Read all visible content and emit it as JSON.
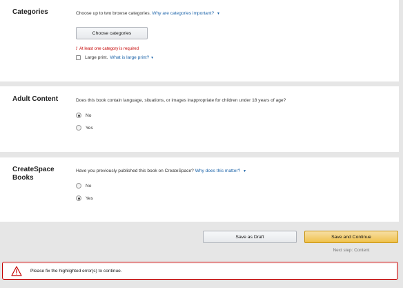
{
  "categories": {
    "title": "Categories",
    "question": "Choose up to two browse categories.",
    "help_link": "Why are categories important?",
    "choose_button": "Choose categories",
    "error": "At least one category is required",
    "large_print_label": "Large print.",
    "large_print_link": "What is large print?"
  },
  "adult": {
    "title": "Adult Content",
    "question": "Does this book contain language, situations, or images inappropriate for children under 18 years of age?",
    "options": [
      {
        "label": "No",
        "checked": true
      },
      {
        "label": "Yes",
        "checked": false
      }
    ]
  },
  "createspace": {
    "title": "CreateSpace Books",
    "question": "Have you previously published this book on CreateSpace?",
    "help_link": "Why does this matter?",
    "options": [
      {
        "label": "No",
        "checked": false
      },
      {
        "label": "Yes",
        "checked": true
      }
    ]
  },
  "footer": {
    "save_draft": "Save as Draft",
    "save_continue": "Save and Continue",
    "next_step": "Next step: Content"
  },
  "alert": {
    "message": "Please fix the highlighted error(s) to continue."
  },
  "icons": {
    "chevron": "chevron-down-icon",
    "alert": "warning-triangle-icon"
  },
  "colors": {
    "link": "#1a62a8",
    "error": "#c40000",
    "primary_button": "#f0c14b"
  }
}
